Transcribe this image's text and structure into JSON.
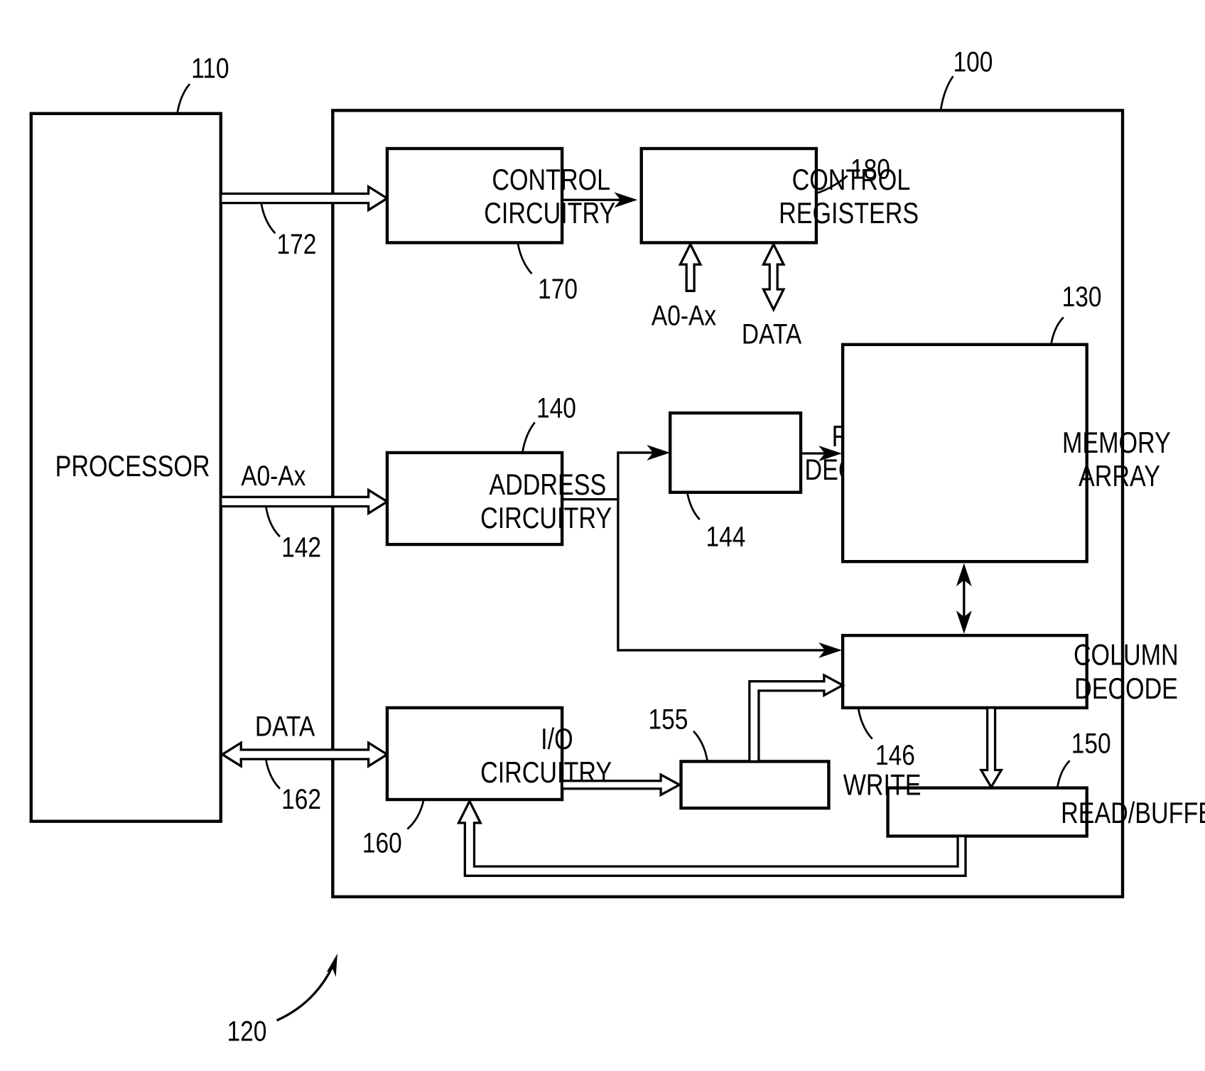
{
  "figure": {
    "system_ref": "120",
    "memory_device_ref": "100"
  },
  "blocks": {
    "processor": {
      "label": "PROCESSOR",
      "ref": "110"
    },
    "control_circuitry": {
      "line1": "CONTROL",
      "line2": "CIRCUITRY",
      "ref": "170"
    },
    "control_registers": {
      "line1": "CONTROL",
      "line2": "REGISTERS",
      "ref": "180"
    },
    "address_circuitry": {
      "line1": "ADDRESS",
      "line2": "CIRCUITRY",
      "ref": "140"
    },
    "row_decode": {
      "line1": "ROW",
      "line2": "DECODE",
      "ref": "144"
    },
    "memory_array": {
      "line1": "MEMORY",
      "line2": "ARRAY",
      "ref": "130"
    },
    "column_decode": {
      "line1": "COLUMN",
      "line2": "DECODE",
      "ref": "146"
    },
    "io_circuitry": {
      "line1": "I/O",
      "line2": "CIRCUITRY",
      "ref": "160"
    },
    "write": {
      "label": "WRITE",
      "ref": "155"
    },
    "read_buffer": {
      "label": "READ/BUFFER",
      "ref": "150"
    }
  },
  "buses": {
    "control_bus": {
      "ref": "172"
    },
    "address_bus": {
      "label": "A0-Ax",
      "ref": "142"
    },
    "data_bus": {
      "label": "DATA",
      "ref": "162"
    },
    "register_address": {
      "label": "A0-Ax"
    },
    "register_data": {
      "label": "DATA"
    }
  }
}
